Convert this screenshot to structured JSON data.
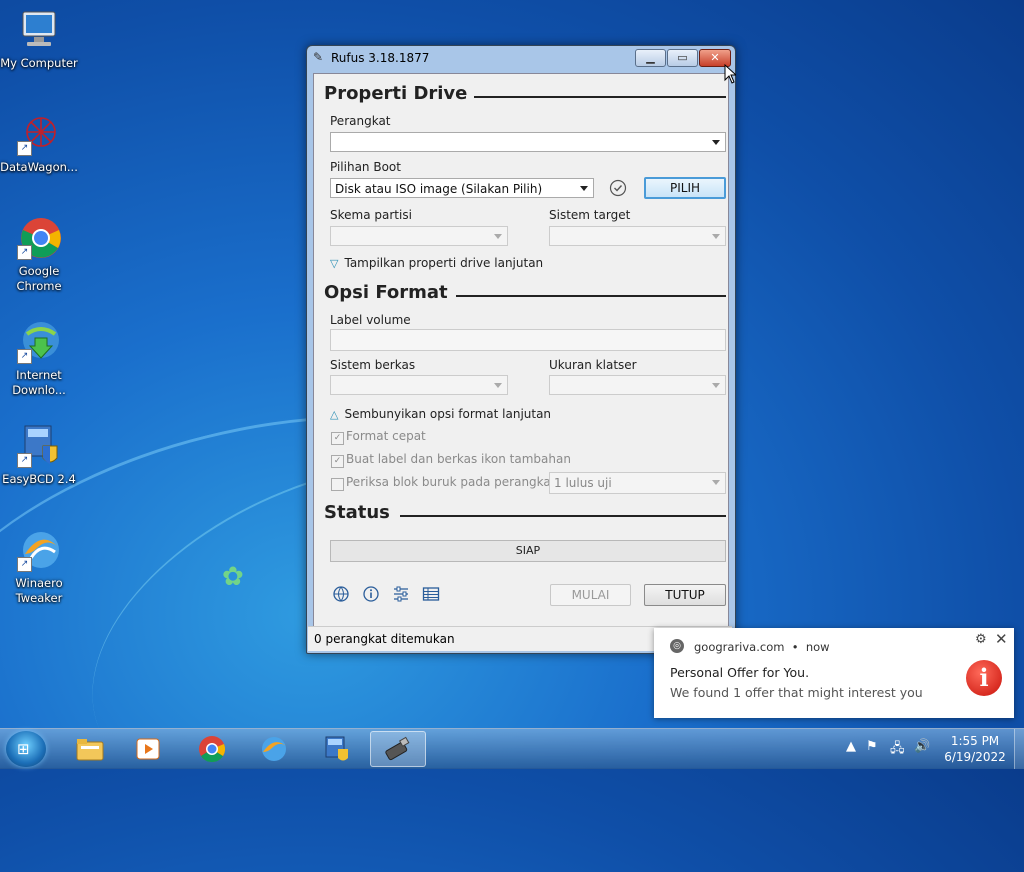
{
  "desktop": {
    "icons": [
      {
        "label": "My Computer",
        "icon": "computer-icon"
      },
      {
        "label": "DataWagon...",
        "icon": "datawagon-icon"
      },
      {
        "label": "Google Chrome",
        "icon": "chrome-icon"
      },
      {
        "label": "Internet Downlo...",
        "icon": "idm-icon"
      },
      {
        "label": "EasyBCD 2.4",
        "icon": "easybcd-icon"
      },
      {
        "label": "Winaero Tweaker",
        "icon": "winaero-icon"
      }
    ]
  },
  "window": {
    "title": "Rufus 3.18.1877",
    "drive_section": {
      "heading": "Properti Drive",
      "device_label": "Perangkat",
      "device_value": "",
      "boot_label": "Pilihan Boot",
      "boot_value": "Disk atau ISO image (Silakan Pilih)",
      "select_button": "PILIH",
      "partition_label": "Skema partisi",
      "target_label": "Sistem target",
      "advanced_toggle": "Tampilkan properti drive lanjutan"
    },
    "format_section": {
      "heading": "Opsi Format",
      "volume_label": "Label volume",
      "volume_value": "",
      "fs_label": "Sistem berkas",
      "cluster_label": "Ukuran klatser",
      "advanced_toggle": "Sembunyikan opsi format lanjutan",
      "quick_format": "Format cepat",
      "extended_label": "Buat label dan berkas ikon tambahan",
      "bad_blocks": "Periksa blok buruk pada perangkat",
      "passes_value": "1 lulus uji"
    },
    "status_section": {
      "heading": "Status",
      "progress_text": "SIAP",
      "start_button": "MULAI",
      "close_button": "TUTUP"
    },
    "statusbar": "0 perangkat ditemukan"
  },
  "notification": {
    "source": "goograriva.com",
    "time": "now",
    "title": "Personal Offer for You.",
    "body": "We found 1 offer that might interest you"
  },
  "taskbar": {
    "time": "1:55 PM",
    "date": "6/19/2022"
  }
}
